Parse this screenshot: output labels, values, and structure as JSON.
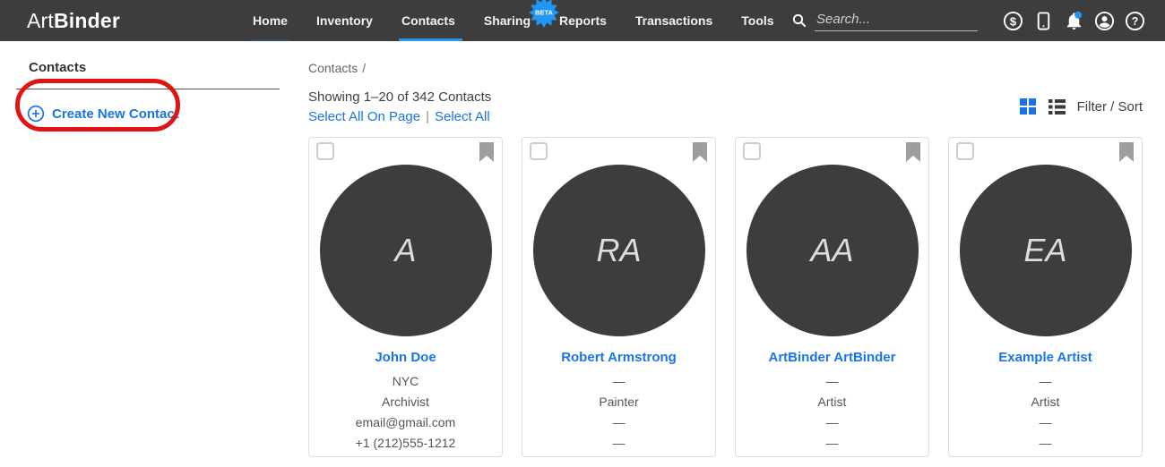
{
  "navbar": {
    "logo": {
      "prefix": "Art",
      "suffix": "Binder"
    },
    "tabs": [
      {
        "label": "Home"
      },
      {
        "label": "Inventory"
      },
      {
        "label": "Contacts"
      },
      {
        "label": "Sharing",
        "badge": "BETA"
      },
      {
        "label": "Reports"
      },
      {
        "label": "Transactions"
      },
      {
        "label": "Tools"
      }
    ],
    "active_tab": "Contacts",
    "search": {
      "placeholder": "Search..."
    },
    "icons": [
      "search-icon",
      "billing-dollar-icon",
      "device-tablet-icon",
      "notifications-bell-icon",
      "account-icon",
      "help-icon"
    ],
    "notification_dot": true
  },
  "sidebar": {
    "title": "Contacts",
    "create_button": {
      "icon": "plus-circle-icon",
      "label": "Create New Contact"
    },
    "annotation": "red highlight circle around Create New Contact"
  },
  "main": {
    "breadcrumb": {
      "label": "Contacts",
      "separator": "/"
    },
    "showing": "Showing 1–20 of 342 Contacts",
    "select_all_on_page": "Select All On Page",
    "pipe": "|",
    "select_all": "Select All",
    "view_toggles": [
      "grid-view-icon",
      "list-view-icon"
    ],
    "active_view": "grid",
    "filter_sort": "Filter / Sort",
    "cards": [
      {
        "initials": "A",
        "name": "John Doe",
        "details": [
          "NYC",
          "Archivist",
          "email@gmail.com",
          "+1 (212)555-1212"
        ]
      },
      {
        "initials": "RA",
        "name": "Robert Armstrong",
        "details": [
          "—",
          "Painter",
          "—",
          "—"
        ]
      },
      {
        "initials": "AA",
        "name": "ArtBinder ArtBinder",
        "details": [
          "—",
          "Artist",
          "—",
          "—"
        ]
      },
      {
        "initials": "EA",
        "name": "Example Artist",
        "details": [
          "—",
          "Artist",
          "—",
          "—"
        ]
      }
    ]
  },
  "colors": {
    "navbar_bg": "#3d3d3d",
    "accent_blue": "#1a73e8",
    "tab_underline": "#2196f3",
    "notification_dot": "#2196f3",
    "annotation_red": "#e01414",
    "avatar_bg": "#3d3d3d",
    "bookmark_gray": "#9e9e9e"
  }
}
